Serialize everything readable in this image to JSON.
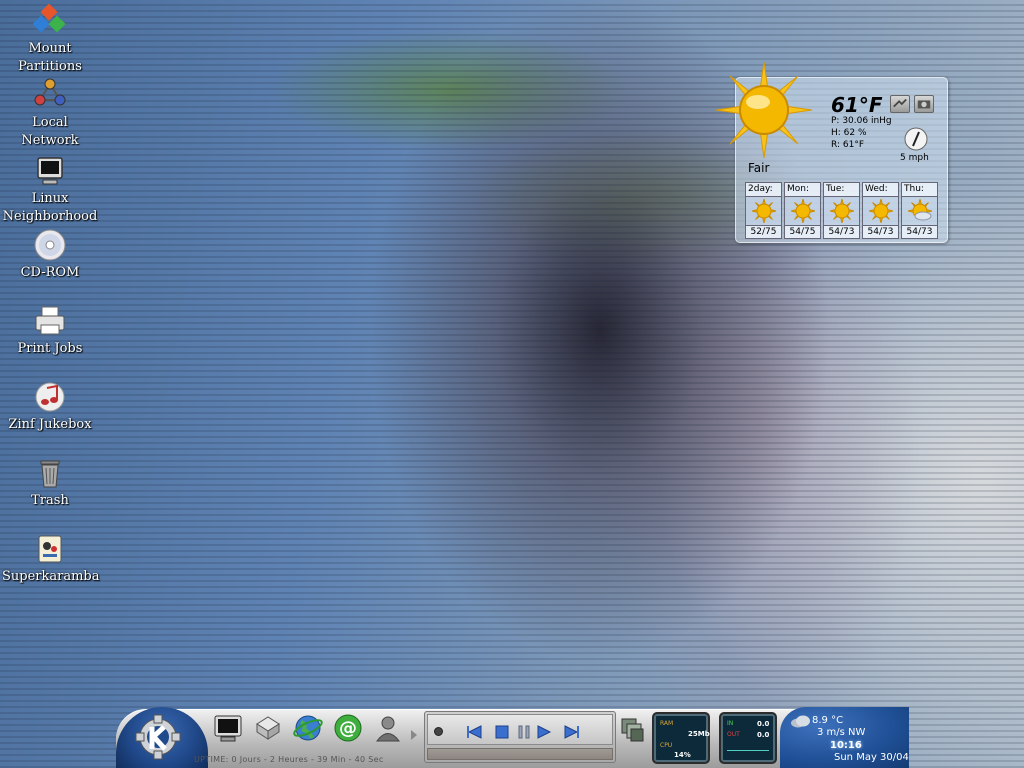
{
  "desktop": {
    "icons": [
      {
        "label": "Mount\nPartitions",
        "icon": "mount-partitions-icon"
      },
      {
        "label": "Local Network",
        "icon": "local-network-icon"
      },
      {
        "label": "Linux\nNeighborhood",
        "icon": "linux-neighborhood-icon"
      },
      {
        "label": "CD-ROM",
        "icon": "cdrom-icon"
      },
      {
        "label": "Print Jobs",
        "icon": "printer-icon"
      },
      {
        "label": "Zinf Jukebox",
        "icon": "jukebox-icon"
      },
      {
        "label": "Trash",
        "icon": "trash-icon"
      },
      {
        "label": "Superkaramba",
        "icon": "superkaramba-icon"
      }
    ]
  },
  "weather": {
    "temperature": "61°F",
    "pressure": "P:  30.06 inHg",
    "humidity": "H:  62 %",
    "real_feel": "R:  61°F",
    "condition": "Fair",
    "wind_speed": "5 mph",
    "forecast": [
      {
        "day": "2day:",
        "range": "52/75"
      },
      {
        "day": "Mon:",
        "range": "54/75"
      },
      {
        "day": "Tue:",
        "range": "54/73"
      },
      {
        "day": "Wed:",
        "range": "54/73"
      },
      {
        "day": "Thu:",
        "range": "54/73"
      }
    ]
  },
  "panel": {
    "uptime": "UPTIME: 0 Jours - 2 Heures - 39 Min - 40 Sec",
    "monitors": {
      "ram_label": "RAM",
      "ram_value": "25Mb",
      "cpu_label": "CPU",
      "cpu_value": "14%",
      "net_in_label": "IN",
      "net_in_value": "0.0",
      "net_out_label": "OUT",
      "net_out_value": "0.0"
    },
    "clock": {
      "temperature": "8.9 °C",
      "wind": "3 m/s NW",
      "time": "10:16",
      "date": "Sun May 30/04"
    }
  },
  "colors": {
    "panel_blue": "#214a8c",
    "sun": "#f5b800",
    "monitor_bg": "#0d2a3a"
  }
}
